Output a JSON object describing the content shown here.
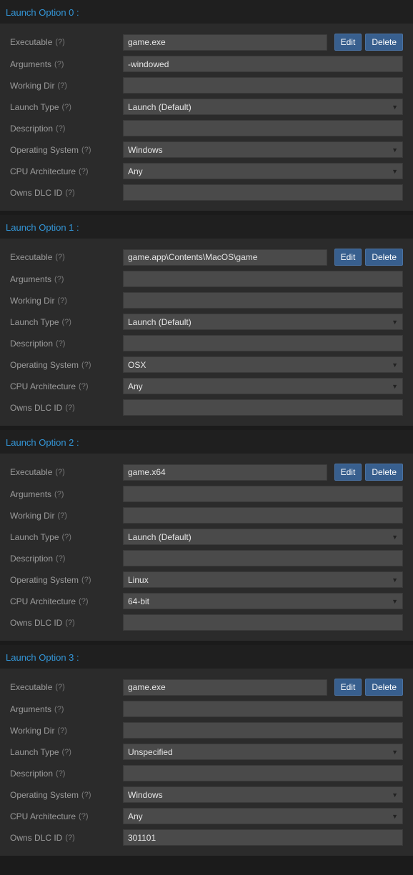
{
  "buttons": {
    "edit": "Edit",
    "delete": "Delete"
  },
  "labels": {
    "executable": "Executable",
    "arguments": "Arguments",
    "working_dir": "Working Dir",
    "launch_type": "Launch Type",
    "description": "Description",
    "os": "Operating System",
    "cpu": "CPU Architecture",
    "owns_dlc": "Owns DLC ID",
    "help": "(?)"
  },
  "options": [
    {
      "title": "Launch Option 0 :",
      "executable": "game.exe",
      "arguments": "-windowed",
      "working_dir": "",
      "launch_type": "Launch (Default)",
      "description": "",
      "os": "Windows",
      "cpu": "Any",
      "owns_dlc": ""
    },
    {
      "title": "Launch Option 1 :",
      "executable": "game.app\\Contents\\MacOS\\game",
      "arguments": "",
      "working_dir": "",
      "launch_type": "Launch (Default)",
      "description": "",
      "os": "OSX",
      "cpu": "Any",
      "owns_dlc": ""
    },
    {
      "title": "Launch Option 2 :",
      "executable": "game.x64",
      "arguments": "",
      "working_dir": "",
      "launch_type": "Launch (Default)",
      "description": "",
      "os": "Linux",
      "cpu": "64-bit",
      "owns_dlc": ""
    },
    {
      "title": "Launch Option 3 :",
      "executable": "game.exe",
      "arguments": "",
      "working_dir": "",
      "launch_type": "Unspecified",
      "description": "",
      "os": "Windows",
      "cpu": "Any",
      "owns_dlc": "301101"
    }
  ]
}
